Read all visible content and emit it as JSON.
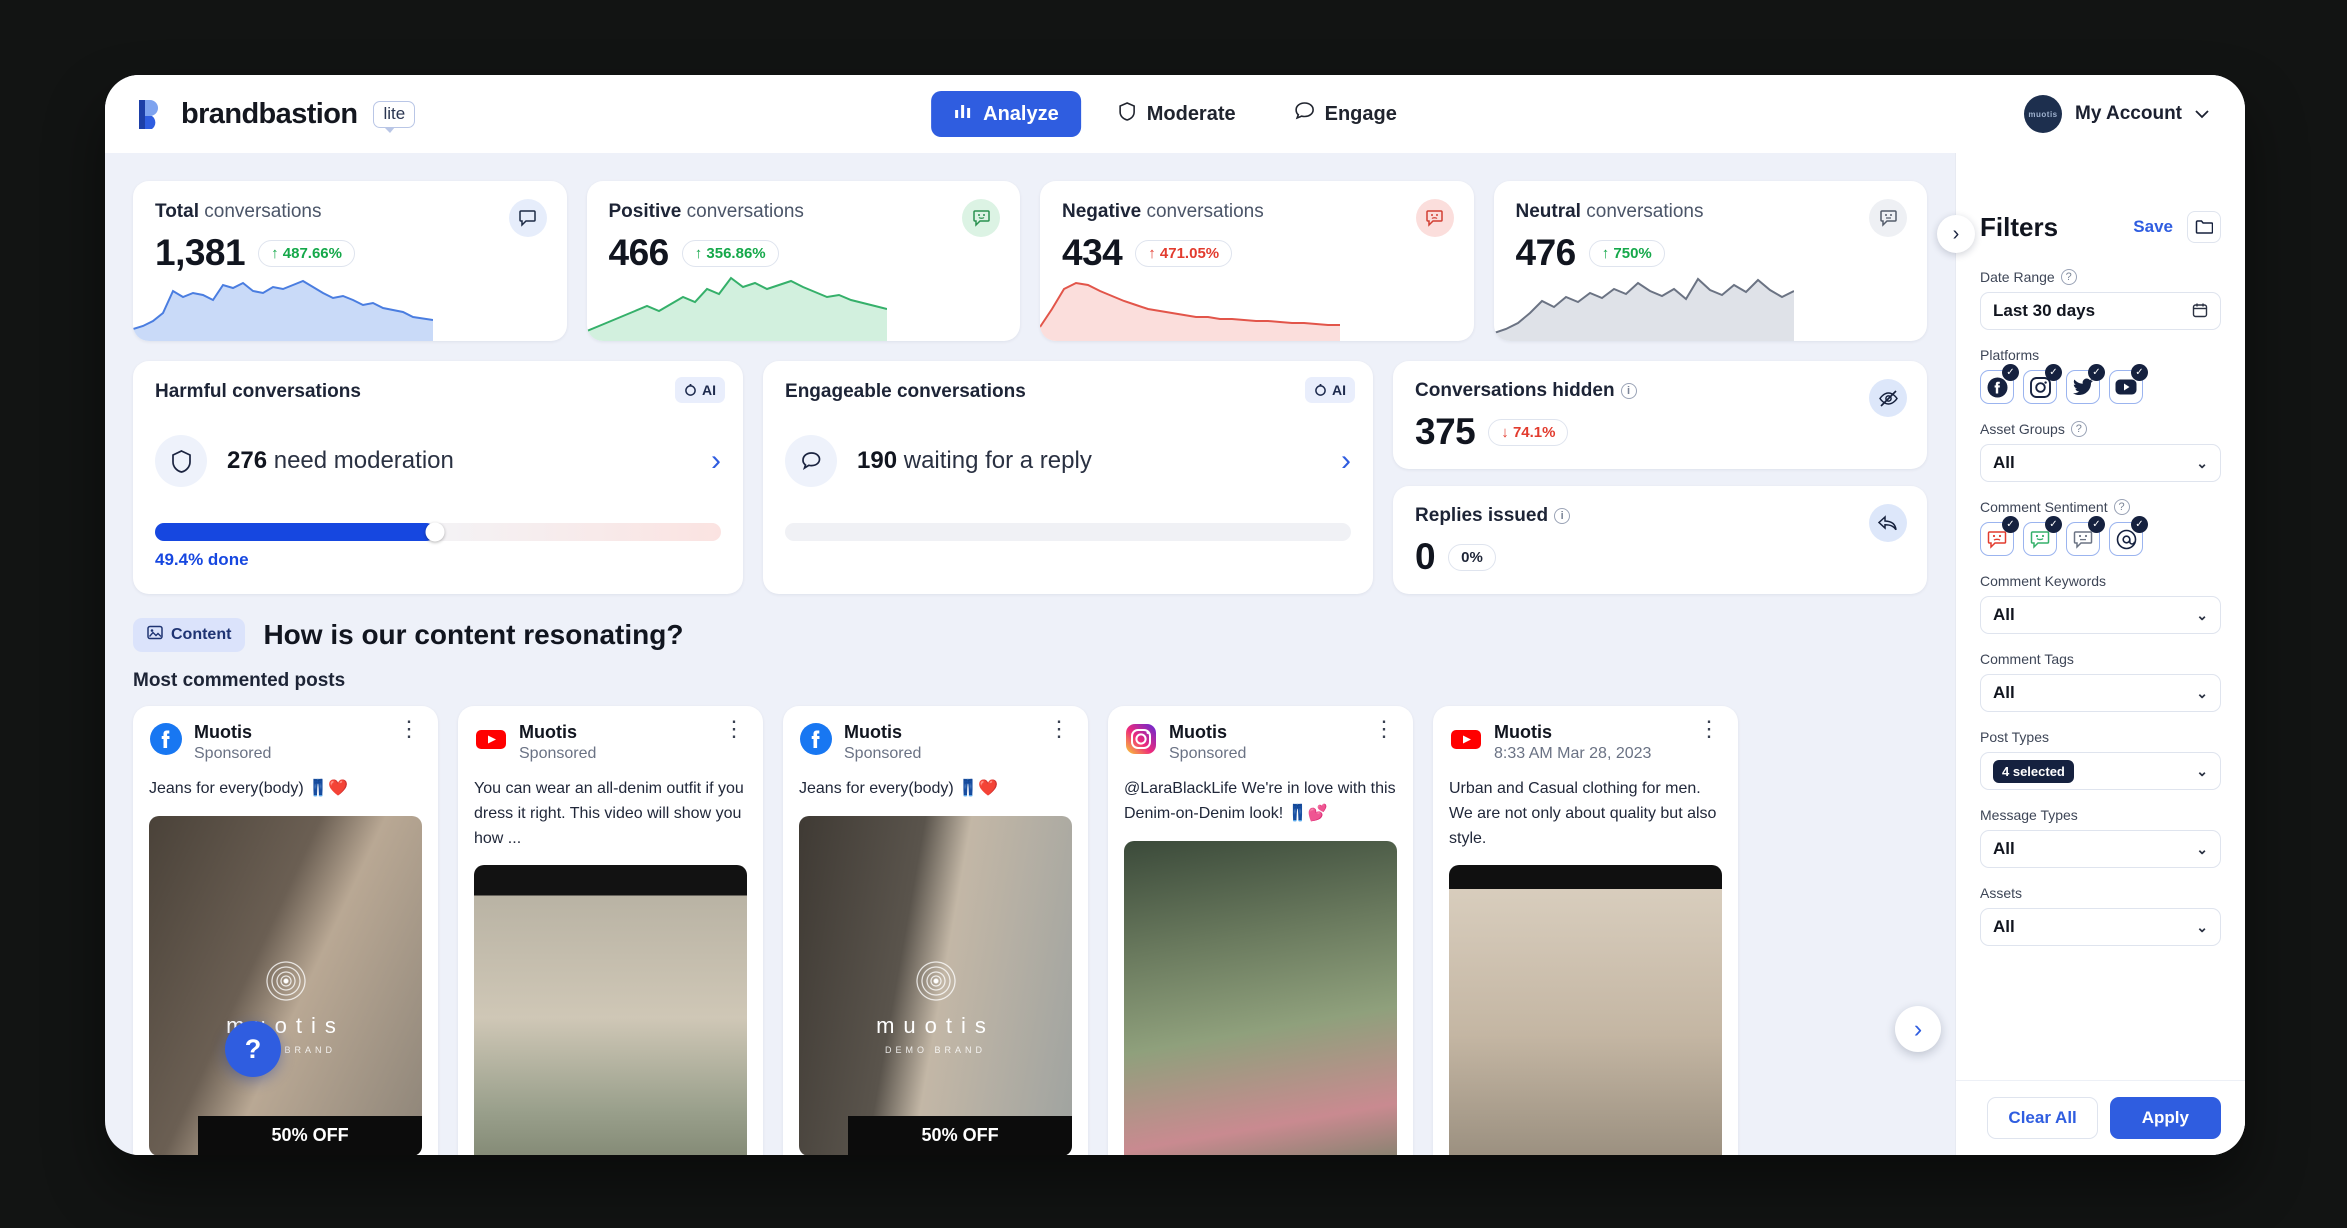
{
  "header": {
    "brand": "brandbastion",
    "brand_badge": "lite",
    "tabs": [
      {
        "label": "Analyze",
        "icon": "bar-chart-icon",
        "active": true
      },
      {
        "label": "Moderate",
        "icon": "shield-icon",
        "active": false
      },
      {
        "label": "Engage",
        "icon": "chat-bubble-icon",
        "active": false
      }
    ],
    "account_label": "My Account",
    "avatar_text": "muotis"
  },
  "stats": [
    {
      "title_bold": "Total",
      "title_rest": " conversations",
      "value": "1,381",
      "delta": "487.66%",
      "dir": "up",
      "icon": "chat-bubble-icon",
      "accent": "#4a7de0"
    },
    {
      "title_bold": "Positive",
      "title_rest": " conversations",
      "value": "466",
      "delta": "356.86%",
      "dir": "up",
      "icon": "smile-chat-icon",
      "accent": "#35b06a"
    },
    {
      "title_bold": "Negative",
      "title_rest": " conversations",
      "value": "434",
      "delta": "471.05%",
      "dir": "up-red",
      "icon": "sad-chat-icon",
      "accent": "#e2554a"
    },
    {
      "title_bold": "Neutral",
      "title_rest": " conversations",
      "value": "476",
      "delta": "750%",
      "dir": "up",
      "icon": "neutral-chat-icon",
      "accent": "#6b7383"
    }
  ],
  "harmful": {
    "title": "Harmful conversations",
    "ai_badge": "AI",
    "count": "276",
    "count_label": " need moderation",
    "progress_label": "49.4% done",
    "progress_pct": 49.4
  },
  "engageable": {
    "title": "Engageable conversations",
    "ai_badge": "AI",
    "count": "190",
    "count_label": " waiting for a reply"
  },
  "hidden_card": {
    "title": "Conversations hidden",
    "value": "375",
    "delta": "74.1%",
    "dir": "down",
    "icon": "eye-off-icon"
  },
  "replies_card": {
    "title": "Replies issued",
    "value": "0",
    "delta": "0%",
    "dir": "flat",
    "icon": "reply-icon"
  },
  "content_section": {
    "chip": "Content",
    "chip_icon": "image-icon",
    "question": "How is our content resonating?",
    "subhead": "Most commented posts"
  },
  "posts": [
    {
      "platform": "facebook",
      "name": "Muotis",
      "meta": "Sponsored",
      "text": "Jeans for every(body) 👖❤️",
      "image_brand": "muotis",
      "image_sub": "DEMO BRAND",
      "sale": "50% OFF"
    },
    {
      "platform": "youtube",
      "name": "Muotis",
      "meta": "Sponsored",
      "text": "You can wear an all-denim outfit if you dress it right. This video will show you how ...",
      "image_brand": "",
      "image_sub": "",
      "sale": ""
    },
    {
      "platform": "facebook",
      "name": "Muotis",
      "meta": "Sponsored",
      "text": "Jeans for every(body) 👖❤️",
      "image_brand": "muotis",
      "image_sub": "DEMO BRAND",
      "sale": "50% OFF"
    },
    {
      "platform": "instagram",
      "name": "Muotis",
      "meta": "Sponsored",
      "text": "@LaraBlackLife We're in love with this Denim-on-Denim look! 👖💕",
      "image_brand": "",
      "image_sub": "",
      "sale": ""
    },
    {
      "platform": "youtube",
      "name": "Muotis",
      "meta": "8:33 AM Mar 28, 2023",
      "text": "Urban and Casual clothing for men. We are not only about quality but also style.",
      "image_brand": "",
      "image_sub": "",
      "sale": ""
    }
  ],
  "filters": {
    "title": "Filters",
    "save_label": "Save",
    "folder_icon": "folder-icon",
    "collapse_icon": "chevron-right-icon",
    "date_range": {
      "label": "Date Range",
      "value": "Last 30 days",
      "icon": "calendar-icon",
      "has_info": true
    },
    "platforms": {
      "label": "Platforms",
      "items": [
        {
          "name": "facebook-icon",
          "checked": true
        },
        {
          "name": "instagram-icon",
          "checked": true
        },
        {
          "name": "twitter-icon",
          "checked": true
        },
        {
          "name": "youtube-icon",
          "checked": true
        }
      ]
    },
    "asset_groups": {
      "label": "Asset Groups",
      "value": "All",
      "has_info": true
    },
    "comment_sentiment": {
      "label": "Comment Sentiment",
      "has_info": true,
      "items": [
        {
          "name": "negative-sentiment-icon",
          "checked": true
        },
        {
          "name": "positive-sentiment-icon",
          "checked": true
        },
        {
          "name": "neutral-sentiment-icon",
          "checked": true
        },
        {
          "name": "mention-icon",
          "checked": true
        }
      ]
    },
    "comment_keywords": {
      "label": "Comment Keywords",
      "value": "All"
    },
    "comment_tags": {
      "label": "Comment Tags",
      "value": "All"
    },
    "post_types": {
      "label": "Post Types",
      "value": "4 selected",
      "is_badge": true
    },
    "message_types": {
      "label": "Message Types",
      "value": "All"
    },
    "assets": {
      "label": "Assets",
      "value": "All"
    },
    "clear_all": "Clear All",
    "apply": "Apply"
  },
  "help_button": "?",
  "chart_data": [
    {
      "type": "area",
      "title": "Total conversations sparkline",
      "color": "#4a7de0",
      "values": [
        18,
        20,
        24,
        30,
        52,
        46,
        50,
        48,
        44,
        58,
        55,
        60,
        52,
        50,
        56,
        54,
        58,
        62,
        56,
        50,
        46,
        48,
        44,
        40,
        42,
        38,
        36,
        34,
        30,
        28
      ]
    },
    {
      "type": "area",
      "title": "Positive conversations sparkline",
      "color": "#35b06a",
      "values": [
        14,
        18,
        22,
        26,
        30,
        34,
        30,
        36,
        42,
        38,
        48,
        44,
        60,
        52,
        56,
        50,
        54,
        58,
        52,
        48,
        44,
        46,
        42,
        40,
        38,
        36,
        34,
        32,
        30,
        28
      ]
    },
    {
      "type": "area",
      "title": "Negative conversations sparkline",
      "color": "#e2554a",
      "values": [
        20,
        40,
        58,
        62,
        60,
        54,
        50,
        46,
        42,
        38,
        36,
        34,
        32,
        30,
        30,
        28,
        28,
        27,
        26,
        26,
        25,
        24,
        24,
        23,
        22,
        22,
        21,
        20,
        20,
        19
      ]
    },
    {
      "type": "area",
      "title": "Neutral conversations sparkline",
      "color": "#6b7383",
      "values": [
        12,
        16,
        22,
        30,
        40,
        36,
        44,
        40,
        48,
        44,
        52,
        48,
        56,
        50,
        46,
        52,
        44,
        58,
        50,
        46,
        54,
        48,
        58,
        50,
        44,
        52,
        46,
        42,
        38,
        34
      ]
    }
  ]
}
